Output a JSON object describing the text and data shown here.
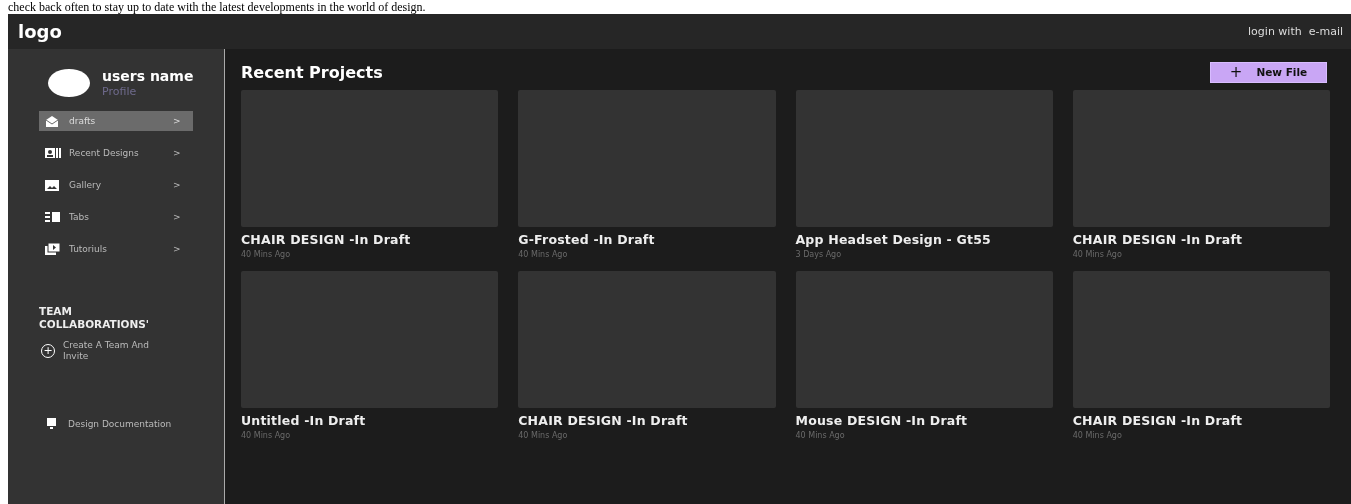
{
  "page_caption": "check back often to stay up to date with the latest developments in the world of design.",
  "header": {
    "logo": "logo",
    "login": "login with  e-mail"
  },
  "sidebar": {
    "user_name": "users name",
    "profile": "Profile",
    "items": [
      {
        "label": "drafts",
        "chevron": ">",
        "selected": true
      },
      {
        "label": "Recent Designs",
        "chevron": ">",
        "selected": false
      },
      {
        "label": "Gallery",
        "chevron": ">",
        "selected": false
      },
      {
        "label": "Tabs",
        "chevron": ">",
        "selected": false
      },
      {
        "label": "Tutoriuls",
        "chevron": ">",
        "selected": false
      }
    ],
    "team_heading": "TEAM COLLABORATIONS'",
    "team_action": {
      "icon": "+",
      "label": "Create A Team And Invite"
    },
    "documentation": "Design Documentation"
  },
  "main": {
    "title": "Recent Projects",
    "new_file": {
      "icon": "+",
      "label": "New File"
    },
    "projects": [
      {
        "title": "CHAIR DESIGN -In Draft",
        "time": "40 Mins Ago"
      },
      {
        "title": "G-Frosted -In Draft",
        "time": "40 Mins Ago"
      },
      {
        "title": "App Headset Design - Gt55",
        "time": "3 Days Ago"
      },
      {
        "title": "CHAIR DESIGN -In Draft",
        "time": "40 Mins Ago"
      },
      {
        "title": "Untitled -In Draft",
        "time": "40 Mins Ago"
      },
      {
        "title": "CHAIR DESIGN -In Draft",
        "time": "40 Mins Ago"
      },
      {
        "title": "Mouse DESIGN -In Draft",
        "time": "40 Mins Ago"
      },
      {
        "title": "CHAIR DESIGN -In Draft",
        "time": "40 Mins Ago"
      }
    ]
  }
}
